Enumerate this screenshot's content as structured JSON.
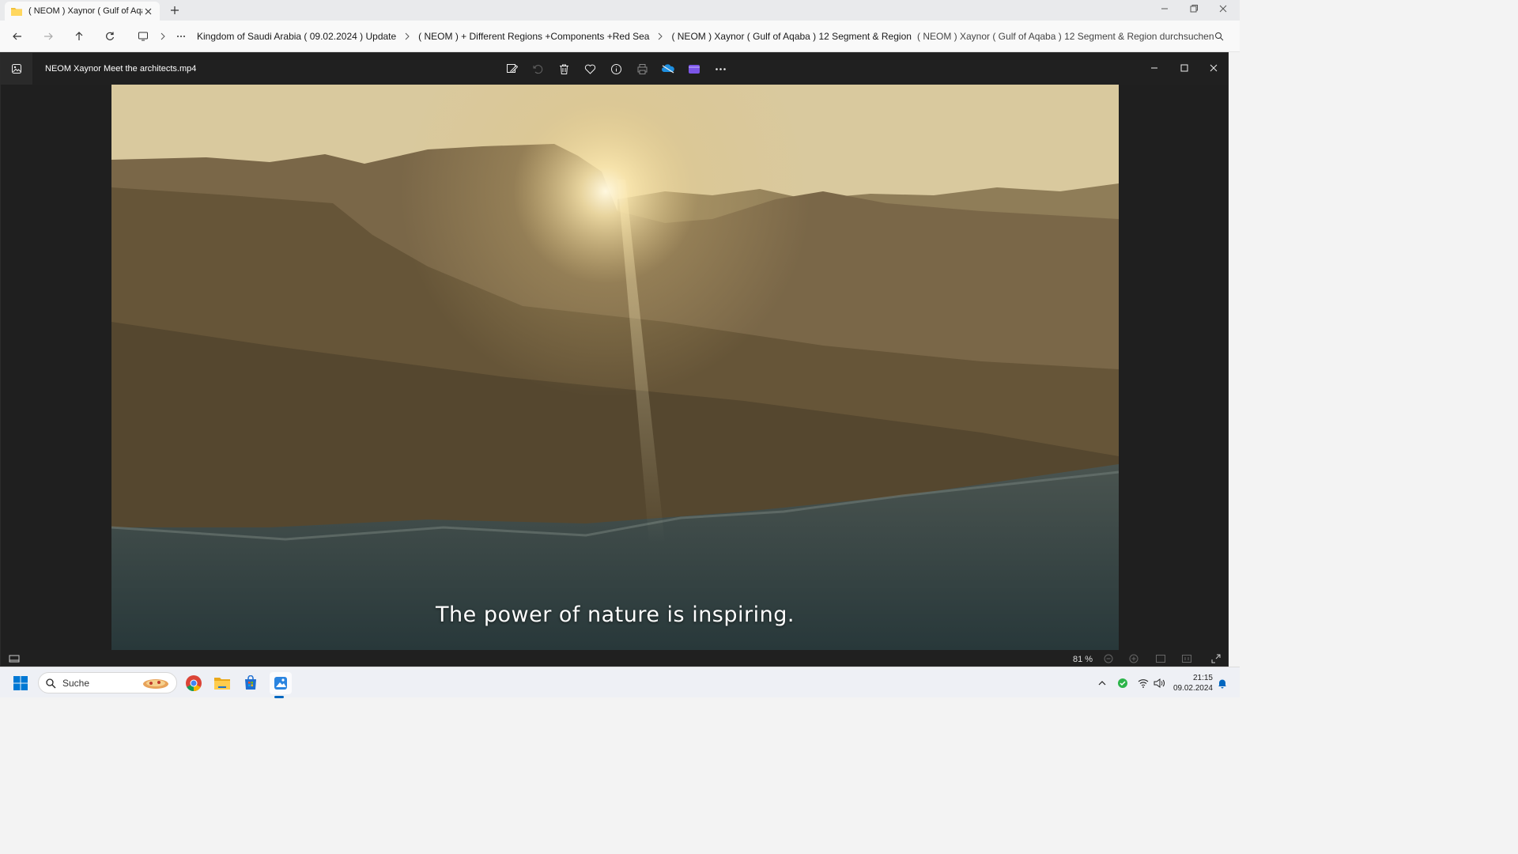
{
  "explorer": {
    "tab_title": "( NEOM ) Xaynor ( Gulf of Aqa",
    "breadcrumbs": [
      "Kingdom of Saudi Arabia ( 09.02.2024 ) Update",
      "( NEOM ) + Different Regions +Components +Red Sea",
      "( NEOM ) Xaynor ( Gulf of Aqaba ) 12 Segment & Region"
    ],
    "search_placeholder": "( NEOM ) Xaynor ( Gulf of Aqaba ) 12 Segment & Region durchsuchen"
  },
  "photos": {
    "filename": "NEOM  Xaynor  Meet the architects.mp4",
    "toolbar": [
      "edit-icon",
      "rotate-icon",
      "delete-icon",
      "favorite-icon",
      "info-icon",
      "print-icon",
      "onedrive-icon",
      "clipchamp-icon",
      "more-icon"
    ],
    "subtitle": "The power of nature is inspiring.",
    "zoom": "81 %"
  },
  "taskbar": {
    "search_label": "Suche",
    "time": "21:15",
    "date": "09.02.2024"
  },
  "colors": {
    "accent": "#0067c0",
    "photos_bg": "#1f1f1f"
  }
}
